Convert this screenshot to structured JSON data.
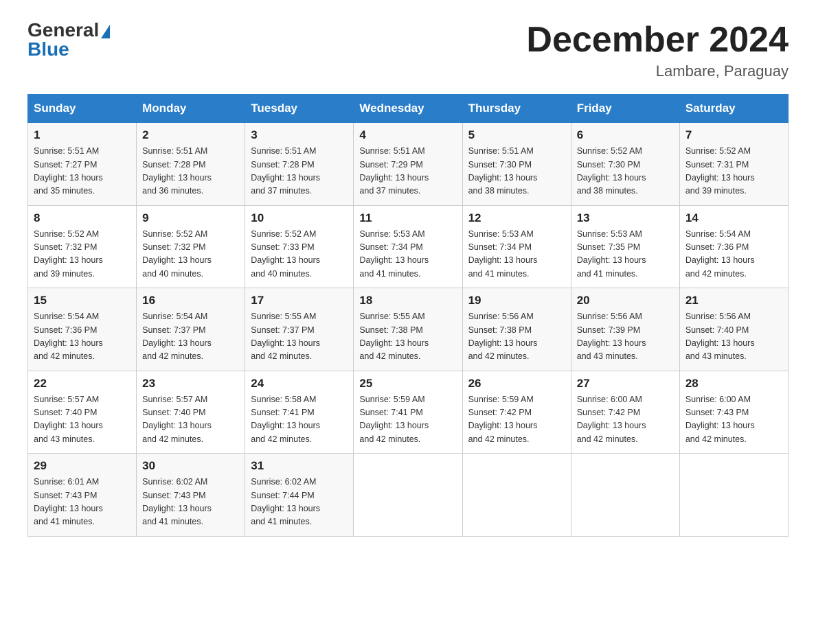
{
  "header": {
    "logo_general": "General",
    "logo_blue": "Blue",
    "month_title": "December 2024",
    "location": "Lambare, Paraguay"
  },
  "days_of_week": [
    "Sunday",
    "Monday",
    "Tuesday",
    "Wednesday",
    "Thursday",
    "Friday",
    "Saturday"
  ],
  "weeks": [
    [
      {
        "day": "1",
        "sunrise": "5:51 AM",
        "sunset": "7:27 PM",
        "daylight": "13 hours and 35 minutes."
      },
      {
        "day": "2",
        "sunrise": "5:51 AM",
        "sunset": "7:28 PM",
        "daylight": "13 hours and 36 minutes."
      },
      {
        "day": "3",
        "sunrise": "5:51 AM",
        "sunset": "7:28 PM",
        "daylight": "13 hours and 37 minutes."
      },
      {
        "day": "4",
        "sunrise": "5:51 AM",
        "sunset": "7:29 PM",
        "daylight": "13 hours and 37 minutes."
      },
      {
        "day": "5",
        "sunrise": "5:51 AM",
        "sunset": "7:30 PM",
        "daylight": "13 hours and 38 minutes."
      },
      {
        "day": "6",
        "sunrise": "5:52 AM",
        "sunset": "7:30 PM",
        "daylight": "13 hours and 38 minutes."
      },
      {
        "day": "7",
        "sunrise": "5:52 AM",
        "sunset": "7:31 PM",
        "daylight": "13 hours and 39 minutes."
      }
    ],
    [
      {
        "day": "8",
        "sunrise": "5:52 AM",
        "sunset": "7:32 PM",
        "daylight": "13 hours and 39 minutes."
      },
      {
        "day": "9",
        "sunrise": "5:52 AM",
        "sunset": "7:32 PM",
        "daylight": "13 hours and 40 minutes."
      },
      {
        "day": "10",
        "sunrise": "5:52 AM",
        "sunset": "7:33 PM",
        "daylight": "13 hours and 40 minutes."
      },
      {
        "day": "11",
        "sunrise": "5:53 AM",
        "sunset": "7:34 PM",
        "daylight": "13 hours and 41 minutes."
      },
      {
        "day": "12",
        "sunrise": "5:53 AM",
        "sunset": "7:34 PM",
        "daylight": "13 hours and 41 minutes."
      },
      {
        "day": "13",
        "sunrise": "5:53 AM",
        "sunset": "7:35 PM",
        "daylight": "13 hours and 41 minutes."
      },
      {
        "day": "14",
        "sunrise": "5:54 AM",
        "sunset": "7:36 PM",
        "daylight": "13 hours and 42 minutes."
      }
    ],
    [
      {
        "day": "15",
        "sunrise": "5:54 AM",
        "sunset": "7:36 PM",
        "daylight": "13 hours and 42 minutes."
      },
      {
        "day": "16",
        "sunrise": "5:54 AM",
        "sunset": "7:37 PM",
        "daylight": "13 hours and 42 minutes."
      },
      {
        "day": "17",
        "sunrise": "5:55 AM",
        "sunset": "7:37 PM",
        "daylight": "13 hours and 42 minutes."
      },
      {
        "day": "18",
        "sunrise": "5:55 AM",
        "sunset": "7:38 PM",
        "daylight": "13 hours and 42 minutes."
      },
      {
        "day": "19",
        "sunrise": "5:56 AM",
        "sunset": "7:38 PM",
        "daylight": "13 hours and 42 minutes."
      },
      {
        "day": "20",
        "sunrise": "5:56 AM",
        "sunset": "7:39 PM",
        "daylight": "13 hours and 43 minutes."
      },
      {
        "day": "21",
        "sunrise": "5:56 AM",
        "sunset": "7:40 PM",
        "daylight": "13 hours and 43 minutes."
      }
    ],
    [
      {
        "day": "22",
        "sunrise": "5:57 AM",
        "sunset": "7:40 PM",
        "daylight": "13 hours and 43 minutes."
      },
      {
        "day": "23",
        "sunrise": "5:57 AM",
        "sunset": "7:40 PM",
        "daylight": "13 hours and 42 minutes."
      },
      {
        "day": "24",
        "sunrise": "5:58 AM",
        "sunset": "7:41 PM",
        "daylight": "13 hours and 42 minutes."
      },
      {
        "day": "25",
        "sunrise": "5:59 AM",
        "sunset": "7:41 PM",
        "daylight": "13 hours and 42 minutes."
      },
      {
        "day": "26",
        "sunrise": "5:59 AM",
        "sunset": "7:42 PM",
        "daylight": "13 hours and 42 minutes."
      },
      {
        "day": "27",
        "sunrise": "6:00 AM",
        "sunset": "7:42 PM",
        "daylight": "13 hours and 42 minutes."
      },
      {
        "day": "28",
        "sunrise": "6:00 AM",
        "sunset": "7:43 PM",
        "daylight": "13 hours and 42 minutes."
      }
    ],
    [
      {
        "day": "29",
        "sunrise": "6:01 AM",
        "sunset": "7:43 PM",
        "daylight": "13 hours and 41 minutes."
      },
      {
        "day": "30",
        "sunrise": "6:02 AM",
        "sunset": "7:43 PM",
        "daylight": "13 hours and 41 minutes."
      },
      {
        "day": "31",
        "sunrise": "6:02 AM",
        "sunset": "7:44 PM",
        "daylight": "13 hours and 41 minutes."
      },
      null,
      null,
      null,
      null
    ]
  ],
  "labels": {
    "sunrise": "Sunrise:",
    "sunset": "Sunset:",
    "daylight": "Daylight:"
  }
}
